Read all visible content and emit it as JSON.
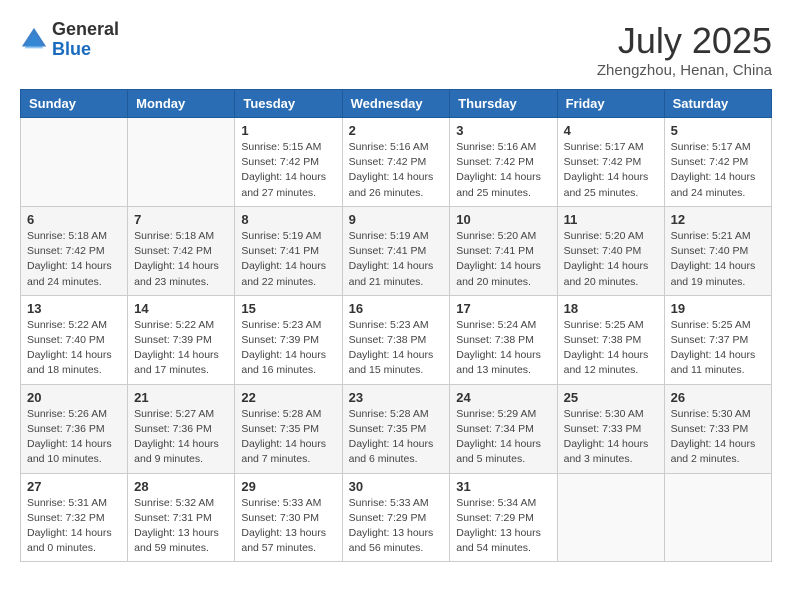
{
  "header": {
    "logo_general": "General",
    "logo_blue": "Blue",
    "month_title": "July 2025",
    "location": "Zhengzhou, Henan, China"
  },
  "weekdays": [
    "Sunday",
    "Monday",
    "Tuesday",
    "Wednesday",
    "Thursday",
    "Friday",
    "Saturday"
  ],
  "weeks": [
    [
      {
        "day": "",
        "info": ""
      },
      {
        "day": "",
        "info": ""
      },
      {
        "day": "1",
        "info": "Sunrise: 5:15 AM\nSunset: 7:42 PM\nDaylight: 14 hours and 27 minutes."
      },
      {
        "day": "2",
        "info": "Sunrise: 5:16 AM\nSunset: 7:42 PM\nDaylight: 14 hours and 26 minutes."
      },
      {
        "day": "3",
        "info": "Sunrise: 5:16 AM\nSunset: 7:42 PM\nDaylight: 14 hours and 25 minutes."
      },
      {
        "day": "4",
        "info": "Sunrise: 5:17 AM\nSunset: 7:42 PM\nDaylight: 14 hours and 25 minutes."
      },
      {
        "day": "5",
        "info": "Sunrise: 5:17 AM\nSunset: 7:42 PM\nDaylight: 14 hours and 24 minutes."
      }
    ],
    [
      {
        "day": "6",
        "info": "Sunrise: 5:18 AM\nSunset: 7:42 PM\nDaylight: 14 hours and 24 minutes."
      },
      {
        "day": "7",
        "info": "Sunrise: 5:18 AM\nSunset: 7:42 PM\nDaylight: 14 hours and 23 minutes."
      },
      {
        "day": "8",
        "info": "Sunrise: 5:19 AM\nSunset: 7:41 PM\nDaylight: 14 hours and 22 minutes."
      },
      {
        "day": "9",
        "info": "Sunrise: 5:19 AM\nSunset: 7:41 PM\nDaylight: 14 hours and 21 minutes."
      },
      {
        "day": "10",
        "info": "Sunrise: 5:20 AM\nSunset: 7:41 PM\nDaylight: 14 hours and 20 minutes."
      },
      {
        "day": "11",
        "info": "Sunrise: 5:20 AM\nSunset: 7:40 PM\nDaylight: 14 hours and 20 minutes."
      },
      {
        "day": "12",
        "info": "Sunrise: 5:21 AM\nSunset: 7:40 PM\nDaylight: 14 hours and 19 minutes."
      }
    ],
    [
      {
        "day": "13",
        "info": "Sunrise: 5:22 AM\nSunset: 7:40 PM\nDaylight: 14 hours and 18 minutes."
      },
      {
        "day": "14",
        "info": "Sunrise: 5:22 AM\nSunset: 7:39 PM\nDaylight: 14 hours and 17 minutes."
      },
      {
        "day": "15",
        "info": "Sunrise: 5:23 AM\nSunset: 7:39 PM\nDaylight: 14 hours and 16 minutes."
      },
      {
        "day": "16",
        "info": "Sunrise: 5:23 AM\nSunset: 7:38 PM\nDaylight: 14 hours and 15 minutes."
      },
      {
        "day": "17",
        "info": "Sunrise: 5:24 AM\nSunset: 7:38 PM\nDaylight: 14 hours and 13 minutes."
      },
      {
        "day": "18",
        "info": "Sunrise: 5:25 AM\nSunset: 7:38 PM\nDaylight: 14 hours and 12 minutes."
      },
      {
        "day": "19",
        "info": "Sunrise: 5:25 AM\nSunset: 7:37 PM\nDaylight: 14 hours and 11 minutes."
      }
    ],
    [
      {
        "day": "20",
        "info": "Sunrise: 5:26 AM\nSunset: 7:36 PM\nDaylight: 14 hours and 10 minutes."
      },
      {
        "day": "21",
        "info": "Sunrise: 5:27 AM\nSunset: 7:36 PM\nDaylight: 14 hours and 9 minutes."
      },
      {
        "day": "22",
        "info": "Sunrise: 5:28 AM\nSunset: 7:35 PM\nDaylight: 14 hours and 7 minutes."
      },
      {
        "day": "23",
        "info": "Sunrise: 5:28 AM\nSunset: 7:35 PM\nDaylight: 14 hours and 6 minutes."
      },
      {
        "day": "24",
        "info": "Sunrise: 5:29 AM\nSunset: 7:34 PM\nDaylight: 14 hours and 5 minutes."
      },
      {
        "day": "25",
        "info": "Sunrise: 5:30 AM\nSunset: 7:33 PM\nDaylight: 14 hours and 3 minutes."
      },
      {
        "day": "26",
        "info": "Sunrise: 5:30 AM\nSunset: 7:33 PM\nDaylight: 14 hours and 2 minutes."
      }
    ],
    [
      {
        "day": "27",
        "info": "Sunrise: 5:31 AM\nSunset: 7:32 PM\nDaylight: 14 hours and 0 minutes."
      },
      {
        "day": "28",
        "info": "Sunrise: 5:32 AM\nSunset: 7:31 PM\nDaylight: 13 hours and 59 minutes."
      },
      {
        "day": "29",
        "info": "Sunrise: 5:33 AM\nSunset: 7:30 PM\nDaylight: 13 hours and 57 minutes."
      },
      {
        "day": "30",
        "info": "Sunrise: 5:33 AM\nSunset: 7:29 PM\nDaylight: 13 hours and 56 minutes."
      },
      {
        "day": "31",
        "info": "Sunrise: 5:34 AM\nSunset: 7:29 PM\nDaylight: 13 hours and 54 minutes."
      },
      {
        "day": "",
        "info": ""
      },
      {
        "day": "",
        "info": ""
      }
    ]
  ]
}
